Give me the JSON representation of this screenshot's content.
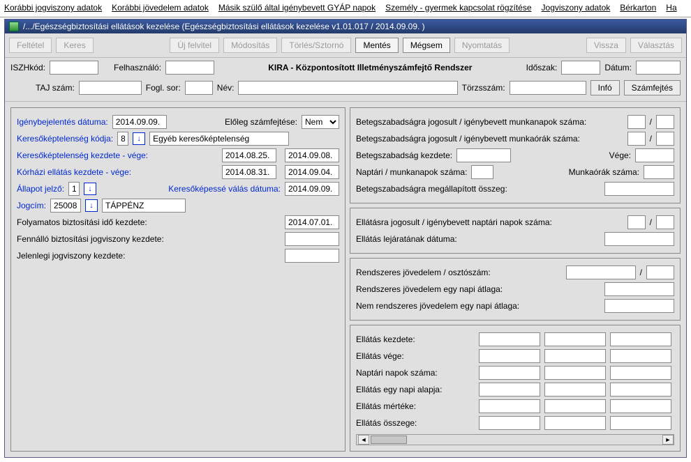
{
  "menu": {
    "items": [
      "Korábbi jogviszony adatok",
      "Korábbi jövedelem adatok",
      "Másik szülő által igénybevett GYÁP napok",
      "Személy - gyermek kapcsolat rögzítése",
      "Jogviszony adatok",
      "Bérkarton",
      "Ha"
    ]
  },
  "title": "/.../Egészségbiztosítási ellátások kezelése (Egészségbiztosítási ellátások kezelése v1.01.017 / 2014.09.09. )",
  "toolbar": {
    "feltetel": "Feltétel",
    "keres": "Keres",
    "uj": "Új felvitel",
    "modositas": "Módosítás",
    "torles": "Törlés/Sztornó",
    "mentes": "Mentés",
    "megsem": "Mégsem",
    "nyomtatas": "Nyomtatás",
    "vissza": "Vissza",
    "valasztas": "Választás"
  },
  "head": {
    "iszhkod": "ISZHkód:",
    "felhasznalo": "Felhasználó:",
    "center": "KIRA - Központosított Illetményszámfejtő Rendszer",
    "idoszak": "Időszak:",
    "datum": "Dátum:",
    "taj": "TAJ szám:",
    "fogl": "Fogl. sor:",
    "nev": "Név:",
    "torzs": "Törzsszám:",
    "info": "Infó",
    "szamfejtes": "Számfejtés"
  },
  "left": {
    "igeny_label": "Igénybejelentés dátuma:",
    "igeny_val": "2014.09.09.",
    "eloleg_label": "Előleg számfejtése:",
    "eloleg_val": "Nem",
    "kk_kod_label": "Keresőképtelenség kódja:",
    "kk_kod_val": "8",
    "kk_kod_text": "Egyéb keresőképtelenség",
    "kk_kezd_label": "Keresőképtelenség kezdete - vége:",
    "kk_kezd_val": "2014.08.25.",
    "kk_vege_val": "2014.09.08.",
    "korhazi_label": "Kórházi ellátás kezdete - vége:",
    "korhazi_kezd": "2014.08.31.",
    "korhazi_vege": "2014.09.04.",
    "allapot_label": "Állapot jelző:",
    "allapot_val": "1",
    "kepesse_label": "Keresőképessé válás dátuma:",
    "kepesse_val": "2014.09.09.",
    "jogcim_label": "Jogcím:",
    "jogcim_val": "25008",
    "jogcim_text": "TÁPPÉNZ",
    "folyamatos_label": "Folyamatos biztosítási idő kezdete:",
    "folyamatos_val": "2014.07.01.",
    "fennallo_label": "Fennálló biztosítási jogviszony kezdete:",
    "jelenlegi_label": "Jelenlegi jogviszony kezdete:"
  },
  "right1": {
    "mnap": "Betegszabadságra jogosult / igénybevett munkanapok száma:",
    "mora": "Betegszabadságra jogosult / igénybevett munkaórák száma:",
    "bkezd": "Betegszabadság kezdete:",
    "vege": "Vége:",
    "naptari": "Naptári / munkanapok száma:",
    "munkaorak": "Munkaórák száma:",
    "megall": "Betegszabadságra megállapított összeg:",
    "slash": "/"
  },
  "right2": {
    "jogosult": "Ellátásra jogosult / igénybevett naptári napok száma:",
    "lejarat": "Ellátás lejáratának dátuma:",
    "slash": "/"
  },
  "right3": {
    "rendszeres": "Rendszeres jövedelem / osztószám:",
    "rnapi": "Rendszeres jövedelem egy napi átlaga:",
    "nrnapi": "Nem rendszeres jövedelem egy napi átlaga:",
    "slash": "/"
  },
  "right4": {
    "rows": [
      "Ellátás kezdete:",
      "Ellátás vége:",
      "Naptári napok száma:",
      "Ellátás egy napi alapja:",
      "Ellátás mértéke:",
      "Ellátás összege:"
    ]
  }
}
